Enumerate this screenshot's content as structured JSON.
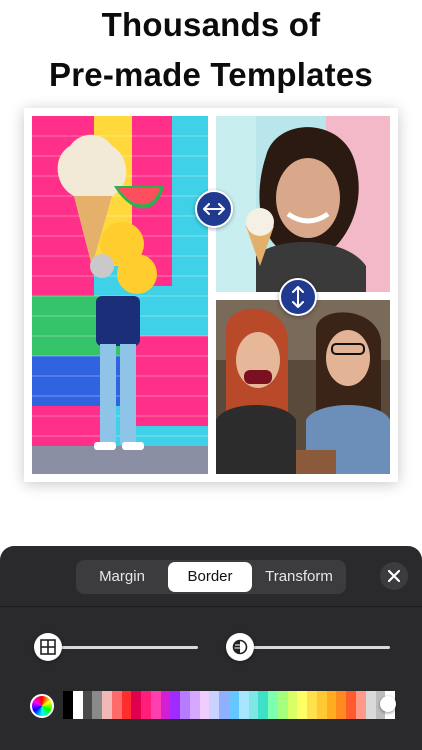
{
  "headline": {
    "line1": "Thousands of",
    "line2": "Pre-made Templates"
  },
  "collage": {
    "cells": [
      {
        "name": "photo-brick-wall-balloons"
      },
      {
        "name": "photo-woman-ice-cream"
      },
      {
        "name": "photo-two-women-couch"
      }
    ],
    "handles": {
      "horizontal_icon": "arrow-left-right-icon",
      "vertical_icon": "arrow-up-down-icon"
    }
  },
  "editor": {
    "tabs": [
      {
        "label": "Margin",
        "selected": false
      },
      {
        "label": "Border",
        "selected": true
      },
      {
        "label": "Transform",
        "selected": false
      }
    ],
    "close_icon": "close-icon",
    "sliders": [
      {
        "icon": "grid-icon",
        "level": 0.0
      },
      {
        "icon": "contrast-icon",
        "level": 0.0
      }
    ],
    "palette": {
      "picker_icon": "color-wheel-icon",
      "selected_index": 33,
      "colors": [
        "#000000",
        "#ffffff",
        "#4a4a4a",
        "#8a8a8a",
        "#f2b8b8",
        "#ff6b6b",
        "#ff2d2d",
        "#e0004f",
        "#ff1f7a",
        "#ff3fb0",
        "#d21fd6",
        "#a02bff",
        "#b77bff",
        "#d7a8ff",
        "#f1ccff",
        "#c9d2ff",
        "#8fb0ff",
        "#66c6ff",
        "#a8e6ff",
        "#7fe6e6",
        "#3fe0c8",
        "#7dffb0",
        "#a6ff7a",
        "#d9ff66",
        "#ffff66",
        "#ffe14d",
        "#ffc933",
        "#ffad1f",
        "#ff8a1f",
        "#ff5c2e",
        "#ff9a8a",
        "#d9d9d9",
        "#bdbdbd",
        "#ffffff"
      ]
    }
  }
}
